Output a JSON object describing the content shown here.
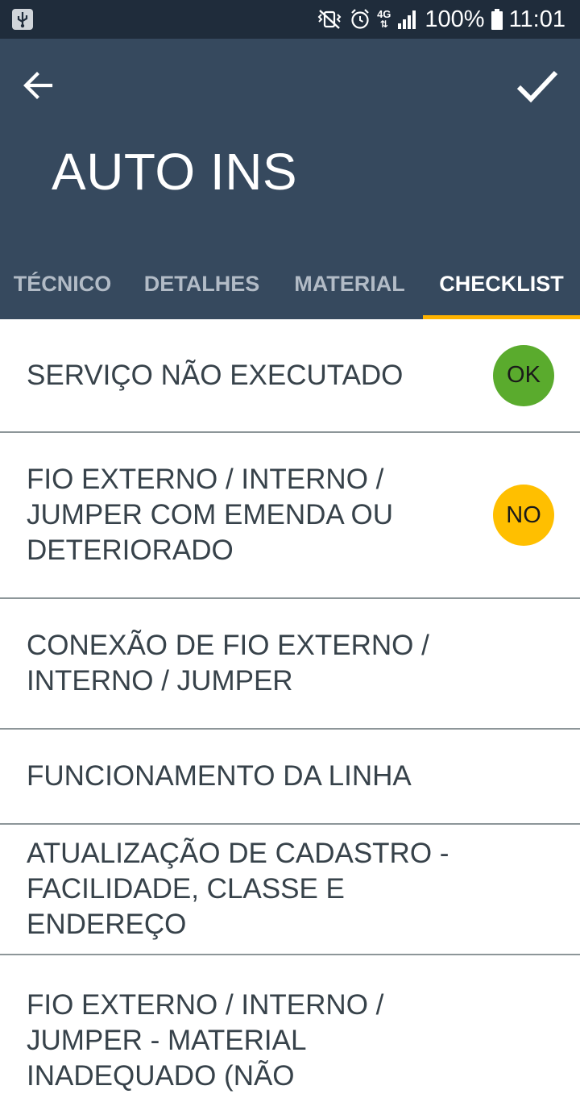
{
  "status_bar": {
    "battery": "100%",
    "time": "11:01",
    "network": "4G"
  },
  "app_bar": {
    "title": "AUTO INS",
    "back_icon": "arrow-back-icon",
    "confirm_icon": "check-icon"
  },
  "tabs": [
    {
      "label": "TÉCNICO",
      "active": false
    },
    {
      "label": "DETALHES",
      "active": false
    },
    {
      "label": "MATERIAL",
      "active": false
    },
    {
      "label": "CHECKLIST",
      "active": true
    }
  ],
  "colors": {
    "status_bar": "#1f2c3b",
    "app_bar": "#36495e",
    "tab_indicator": "#ffb300",
    "ok": "#5aab2d",
    "no": "#ffbf00"
  },
  "checklist": [
    {
      "label": "SERVIÇO NÃO EXECUTADO",
      "status": "OK"
    },
    {
      "label": "FIO EXTERNO / INTERNO / JUMPER COM EMENDA OU DETERIORADO",
      "status": "NO"
    },
    {
      "label": "CONEXÃO DE FIO EXTERNO / INTERNO / JUMPER",
      "status": ""
    },
    {
      "label": "FUNCIONAMENTO DA LINHA",
      "status": ""
    },
    {
      "label": "ATUALIZAÇÃO DE CADASTRO - FACILIDADE, CLASSE E ENDEREÇO",
      "status": ""
    },
    {
      "label": "FIO EXTERNO / INTERNO / JUMPER - MATERIAL INADEQUADO (NÃO",
      "status": ""
    }
  ]
}
